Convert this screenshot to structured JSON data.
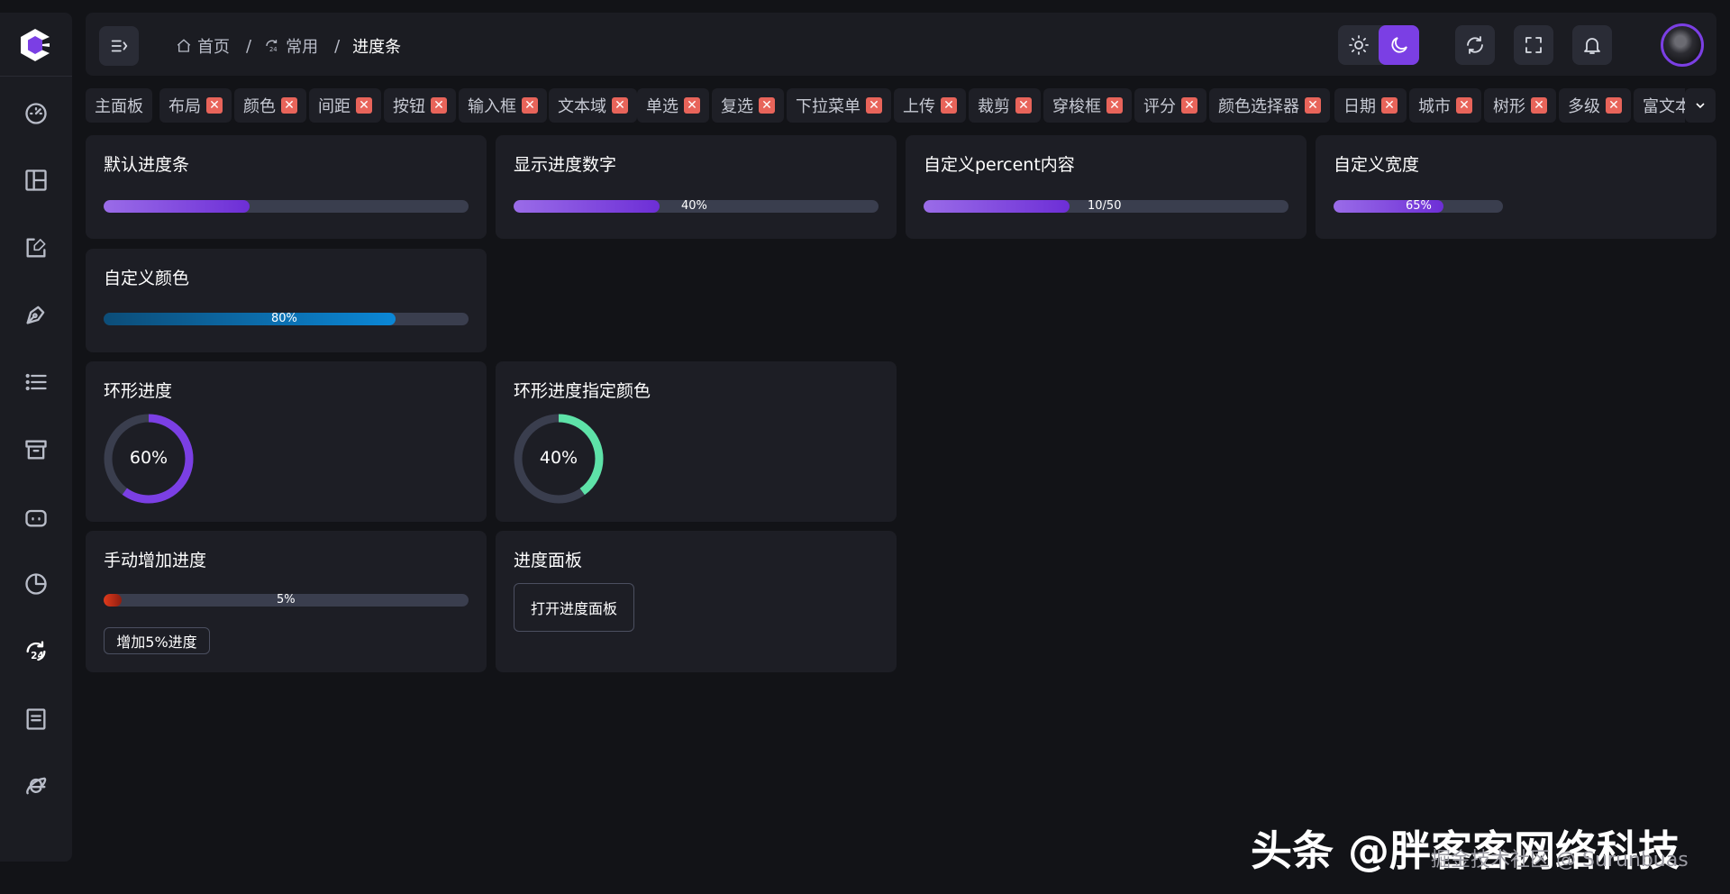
{
  "header": {
    "breadcrumbs": [
      {
        "label": "首页",
        "icon": "home-icon"
      },
      {
        "label": "常用",
        "icon": "refresh-24-icon"
      },
      {
        "label": "进度条"
      }
    ],
    "breadcrumb_separator": "/",
    "theme": {
      "light_icon": "sun-icon",
      "dark_icon": "moon-icon",
      "active": "dark"
    },
    "actions": [
      "refresh-icon",
      "fullscreen-icon",
      "bell-icon"
    ]
  },
  "sidebar": {
    "items": [
      {
        "icon": "dashboard-icon"
      },
      {
        "icon": "layout-icon"
      },
      {
        "icon": "edit-icon"
      },
      {
        "icon": "pen-nib-icon"
      },
      {
        "icon": "list-icon"
      },
      {
        "icon": "archive-icon"
      },
      {
        "icon": "robot-icon"
      },
      {
        "icon": "pie-chart-icon"
      },
      {
        "icon": "refresh-24-icon",
        "active": true
      },
      {
        "icon": "document-icon"
      },
      {
        "icon": "ie-icon"
      }
    ]
  },
  "tabs": {
    "items": [
      {
        "label": "主面板",
        "closable": false
      },
      {
        "label": "布局",
        "closable": true
      },
      {
        "label": "颜色",
        "closable": true
      },
      {
        "label": "间距",
        "closable": true
      },
      {
        "label": "按钮",
        "closable": true
      },
      {
        "label": "输入框",
        "closable": true
      },
      {
        "label": "文本域",
        "closable": true
      },
      {
        "label": "单选",
        "closable": true
      },
      {
        "label": "复选",
        "closable": true
      },
      {
        "label": "下拉菜单",
        "closable": true
      },
      {
        "label": "上传",
        "closable": true
      },
      {
        "label": "裁剪",
        "closable": true
      },
      {
        "label": "穿梭框",
        "closable": true
      },
      {
        "label": "评分",
        "closable": true
      },
      {
        "label": "颜色选择器",
        "closable": true
      },
      {
        "label": "日期",
        "closable": true
      },
      {
        "label": "城市",
        "closable": true
      },
      {
        "label": "树形",
        "closable": true
      },
      {
        "label": "多级",
        "closable": true
      },
      {
        "label": "富文本",
        "closable": false
      }
    ],
    "close_glyph": "✕"
  },
  "cards": {
    "default": {
      "title": "默认进度条",
      "progress": 0.4
    },
    "show_number": {
      "title": "显示进度数字",
      "progress": 0.4,
      "label": "40%"
    },
    "custom_percent": {
      "title": "自定义percent内容",
      "progress": 0.4,
      "label": "10/50"
    },
    "custom_width": {
      "title": "自定义宽度",
      "progress": 0.65,
      "label": "65%"
    },
    "custom_color": {
      "title": "自定义颜色",
      "progress": 0.8,
      "label": "80%"
    },
    "circle": {
      "title": "环形进度",
      "progress": 0.6,
      "label": "60%",
      "color": "#7b3fe4"
    },
    "circle_color": {
      "title": "环形进度指定颜色",
      "progress": 0.4,
      "label": "40%",
      "color": "#5ee2a8"
    },
    "manual": {
      "title": "手动增加进度",
      "progress": 0.05,
      "label": "5%",
      "button": "增加5%进度"
    },
    "panel": {
      "title": "进度面板",
      "button": "打开进度面板"
    }
  },
  "colors": {
    "accent": "#7b3fe4",
    "close": "#e8645a",
    "track": "#3a3e4e"
  },
  "watermark": {
    "main": "头条 @胖客客网络科技",
    "sub": "掘金技术社区 @ Surunbuas"
  }
}
